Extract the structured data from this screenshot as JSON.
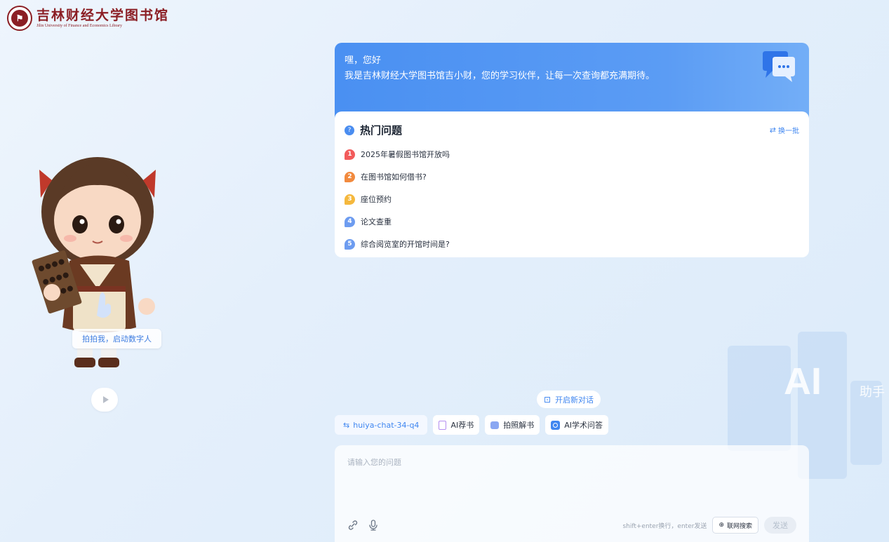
{
  "header": {
    "logo_cn": "吉林财经大学图书馆",
    "logo_en": "Jilin University of Finance and Economics Library"
  },
  "avatar": {
    "start_label": "拍拍我，启动数字人"
  },
  "welcome": {
    "greeting": "嘿，您好",
    "intro": "我是吉林财经大学图书馆吉小财，您的学习伙伴，让每一次查询都充满期待。"
  },
  "hot_questions": {
    "title": "热门问题",
    "refresh_label": "换一批",
    "items": [
      {
        "num": "1",
        "text": "2025年暑假图书馆开放吗",
        "color": "#f25b5b"
      },
      {
        "num": "2",
        "text": "在图书馆如何借书?",
        "color": "#f28a3e"
      },
      {
        "num": "3",
        "text": "座位预约",
        "color": "#f5b83d"
      },
      {
        "num": "4",
        "text": "论文查重",
        "color": "#6d9cf0"
      },
      {
        "num": "5",
        "text": "综合阅览室的开馆时间是?",
        "color": "#6d9cf0"
      }
    ]
  },
  "new_chat_label": "开启新对话",
  "tools": {
    "model": "huiya-chat-34-q4",
    "book_rec": "AI荐书",
    "photo_book": "拍照解书",
    "academic": "AI学术问答"
  },
  "input": {
    "placeholder": "请输入您的问题",
    "hint": "shift+enter换行，enter发送",
    "web_search": "联网搜索",
    "send": "发送"
  },
  "background": {
    "ai_text": "AI",
    "side_text": "助手"
  },
  "colors": {
    "accent": "#3f86f0",
    "brand": "#8b1e24",
    "welcome_bg": "#4a90f2"
  }
}
